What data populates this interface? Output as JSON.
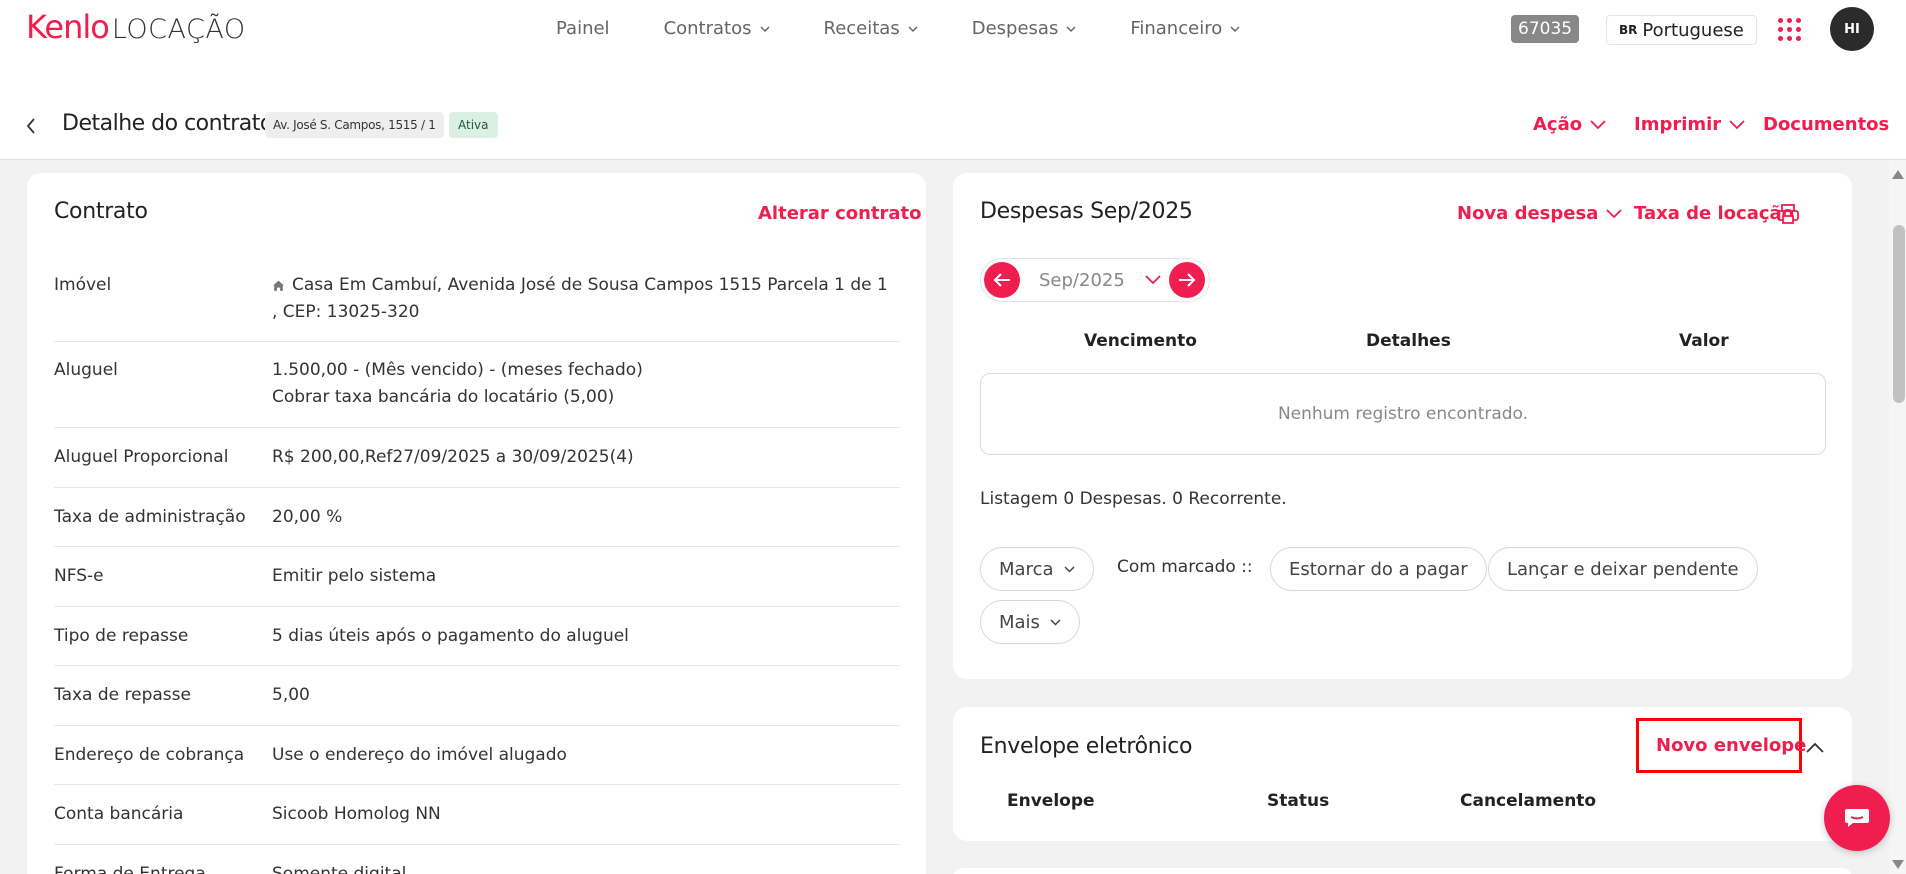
{
  "brand": {
    "name": "Kenlo",
    "product": "LOCAÇÃO",
    "accent": "#f01e4e"
  },
  "nav": {
    "items": [
      {
        "label": "Painel",
        "has_dropdown": false
      },
      {
        "label": "Contratos",
        "has_dropdown": true
      },
      {
        "label": "Receitas",
        "has_dropdown": true
      },
      {
        "label": "Despesas",
        "has_dropdown": true
      },
      {
        "label": "Financeiro",
        "has_dropdown": true
      }
    ],
    "account_number": "67035",
    "language_code": "BR",
    "language": "Portuguese",
    "apps_icon": "grid-dots-icon",
    "avatar_initials": "HI"
  },
  "subheader": {
    "title": "Detalhe do contrato",
    "address_chip": "Av. José S. Campos, 1515 / 1",
    "status": "Ativa",
    "actions": {
      "acao": "Ação",
      "imprimir": "Imprimir",
      "documentos": "Documentos"
    }
  },
  "contract": {
    "title": "Contrato",
    "edit_link": "Alterar contrato",
    "rows": [
      {
        "label": "Imóvel",
        "value": "Casa Em Cambuí, Avenida José de Sousa Campos 1515 Parcela 1 de 1 , CEP: 13025-320",
        "icon": "home-icon"
      },
      {
        "label": "Aluguel",
        "value": "1.500,00 - (Mês vencido) - (meses fechado)",
        "value2": "Cobrar taxa bancária do locatário (5,00)"
      },
      {
        "label": "Aluguel Proporcional",
        "value": "R$ 200,00,Ref27/09/2025 a 30/09/2025(4)"
      },
      {
        "label": "Taxa de administração",
        "value": "20,00 %"
      },
      {
        "label": "NFS-e",
        "value": "Emitir pelo sistema"
      },
      {
        "label": "Tipo de repasse",
        "value": "5 dias úteis após o pagamento do aluguel"
      },
      {
        "label": "Taxa de repasse",
        "value": "5,00"
      },
      {
        "label": "Endereço de cobrança",
        "value": "Use o endereço do imóvel alugado"
      },
      {
        "label": "Conta bancária",
        "value": "Sicoob Homolog NN"
      },
      {
        "label": "Forma de Entrega",
        "value": "Somente digital"
      }
    ]
  },
  "expenses": {
    "title": "Despesas Sep/2025",
    "new_expense": "Nova despesa",
    "rental_fee": "Taxa de locação",
    "month": "Sep/2025",
    "columns": [
      "Vencimento",
      "Detalhes",
      "Valor"
    ],
    "empty_message": "Nenhum registro encontrado.",
    "listing": "Listagem 0 Despesas. 0 Recorrente.",
    "marca": "Marca",
    "com_marcado": "Com marcado ::",
    "estornar": "Estornar do a pagar",
    "lancar": "Lançar e deixar pendente",
    "mais": "Mais"
  },
  "envelope": {
    "title": "Envelope eletrônico",
    "new_envelope": "Novo envelope",
    "columns": [
      "Envelope",
      "Status",
      "Cancelamento"
    ]
  }
}
